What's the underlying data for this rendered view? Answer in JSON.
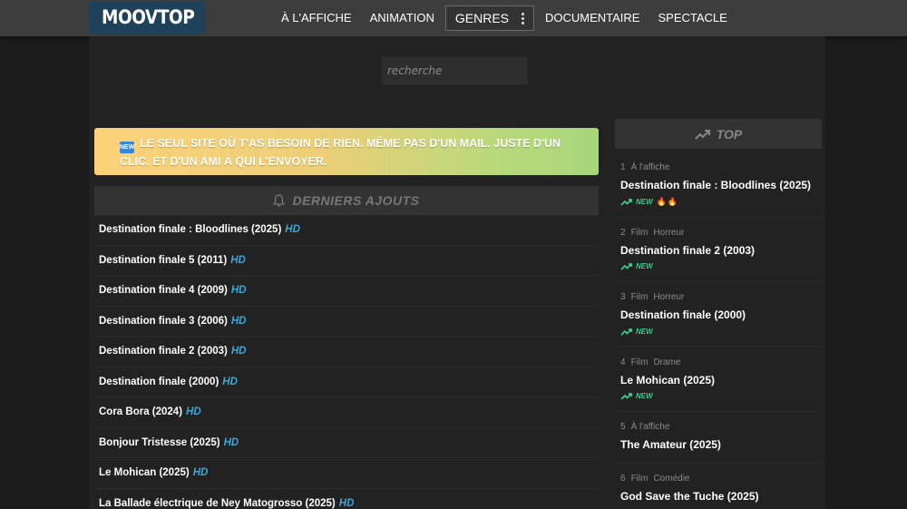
{
  "header": {
    "logo_text": "MOOVTOP",
    "nav": [
      {
        "label": "À L'AFFICHE"
      },
      {
        "label": "ANIMATION"
      },
      {
        "label": "GENRES"
      },
      {
        "label": "DOCUMENTAIRE"
      },
      {
        "label": "SPECTACLE"
      }
    ]
  },
  "search": {
    "placeholder": "recherche"
  },
  "banner": {
    "badge": "NEW",
    "text": "LE SEUL SITE OÙ T'AS BESOIN DE RIEN. MÊME PAS D'UN MAIL. JUSTE D'UN CLIC. ET D'UN AMI À QUI L'ENVOYER."
  },
  "latest": {
    "title": "DERNIERS AJOUTS",
    "items": [
      {
        "title": "Destination finale : Bloodlines (2025)",
        "quality": "HD"
      },
      {
        "title": "Destination finale 5 (2011)",
        "quality": "HD"
      },
      {
        "title": "Destination finale 4 (2009)",
        "quality": "HD"
      },
      {
        "title": "Destination finale 3 (2006)",
        "quality": "HD"
      },
      {
        "title": "Destination finale 2 (2003)",
        "quality": "HD"
      },
      {
        "title": "Destination finale (2000)",
        "quality": "HD"
      },
      {
        "title": "Cora Bora (2024)",
        "quality": "HD"
      },
      {
        "title": "Bonjour Tristesse (2025)",
        "quality": "HD"
      },
      {
        "title": "Le Mohican (2025)",
        "quality": "HD"
      },
      {
        "title": "La Ballade électrique de Ney Matogrosso (2025)",
        "quality": "HD"
      }
    ]
  },
  "top": {
    "title": "TOP",
    "items": [
      {
        "rank": "1",
        "tags": [
          "À l'affiche"
        ],
        "title": "Destination finale : Bloodlines (2025)",
        "badge": "NEW",
        "fire": "🔥🔥"
      },
      {
        "rank": "2",
        "tags": [
          "Film",
          "Horreur"
        ],
        "title": "Destination finale 2 (2003)",
        "badge": "NEW"
      },
      {
        "rank": "3",
        "tags": [
          "Film",
          "Horreur"
        ],
        "title": "Destination finale (2000)",
        "badge": "NEW"
      },
      {
        "rank": "4",
        "tags": [
          "Film",
          "Drame"
        ],
        "title": "Le Mohican (2025)",
        "badge": "NEW"
      },
      {
        "rank": "5",
        "tags": [
          "À l'affiche"
        ],
        "title": "The Amateur (2025)"
      },
      {
        "rank": "6",
        "tags": [
          "Film",
          "Comédie"
        ],
        "title": "God Save the Tuche (2025)"
      }
    ]
  },
  "colors": {
    "hd": "#3aa8d8",
    "new": "#3acb8a",
    "logo_bg": "#1f4159"
  }
}
